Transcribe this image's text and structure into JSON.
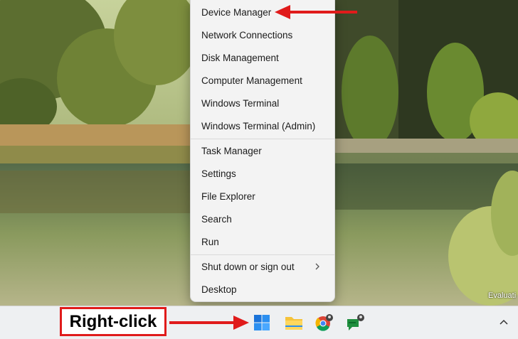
{
  "menu": {
    "items": [
      {
        "label": "Device Manager"
      },
      {
        "label": "Network Connections"
      },
      {
        "label": "Disk Management"
      },
      {
        "label": "Computer Management"
      },
      {
        "label": "Windows Terminal"
      },
      {
        "label": "Windows Terminal (Admin)"
      },
      {
        "label": "Task Manager"
      },
      {
        "label": "Settings"
      },
      {
        "label": "File Explorer"
      },
      {
        "label": "Search"
      },
      {
        "label": "Run"
      },
      {
        "label": "Shut down or sign out"
      },
      {
        "label": "Desktop"
      }
    ]
  },
  "desktop": {
    "watermark": "Evaluati"
  },
  "annotation": {
    "label": "Right-click",
    "color": "#e01b1b"
  },
  "taskbar": {
    "icons": [
      "windows-start-icon",
      "file-explorer-icon",
      "chrome-icon",
      "chat-app-icon"
    ],
    "tray": [
      "chevron-up-icon"
    ]
  }
}
